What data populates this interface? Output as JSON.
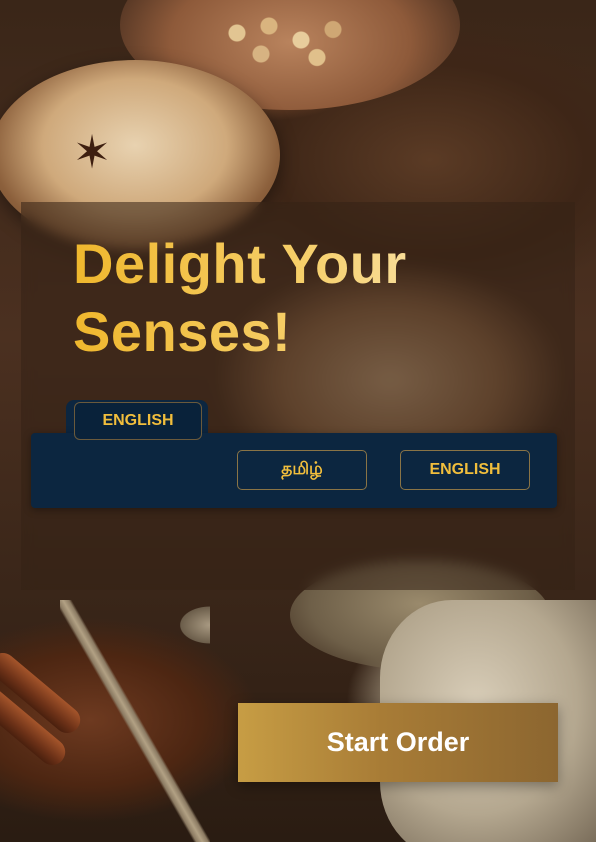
{
  "hero": {
    "headline_line1": "Delight Your",
    "headline_line2": "Senses!"
  },
  "language": {
    "selected_tab_label": "ENGLISH",
    "options": [
      {
        "label": "தமிழ்"
      },
      {
        "label": "ENGLISH"
      }
    ]
  },
  "actions": {
    "start_order_label": "Start Order"
  },
  "colors": {
    "accent_gold": "#f1be3c",
    "panel_navy": "#0c2640",
    "button_gold": "#b8893b"
  },
  "background": {
    "image_subject": "masala chai cups with spices"
  }
}
